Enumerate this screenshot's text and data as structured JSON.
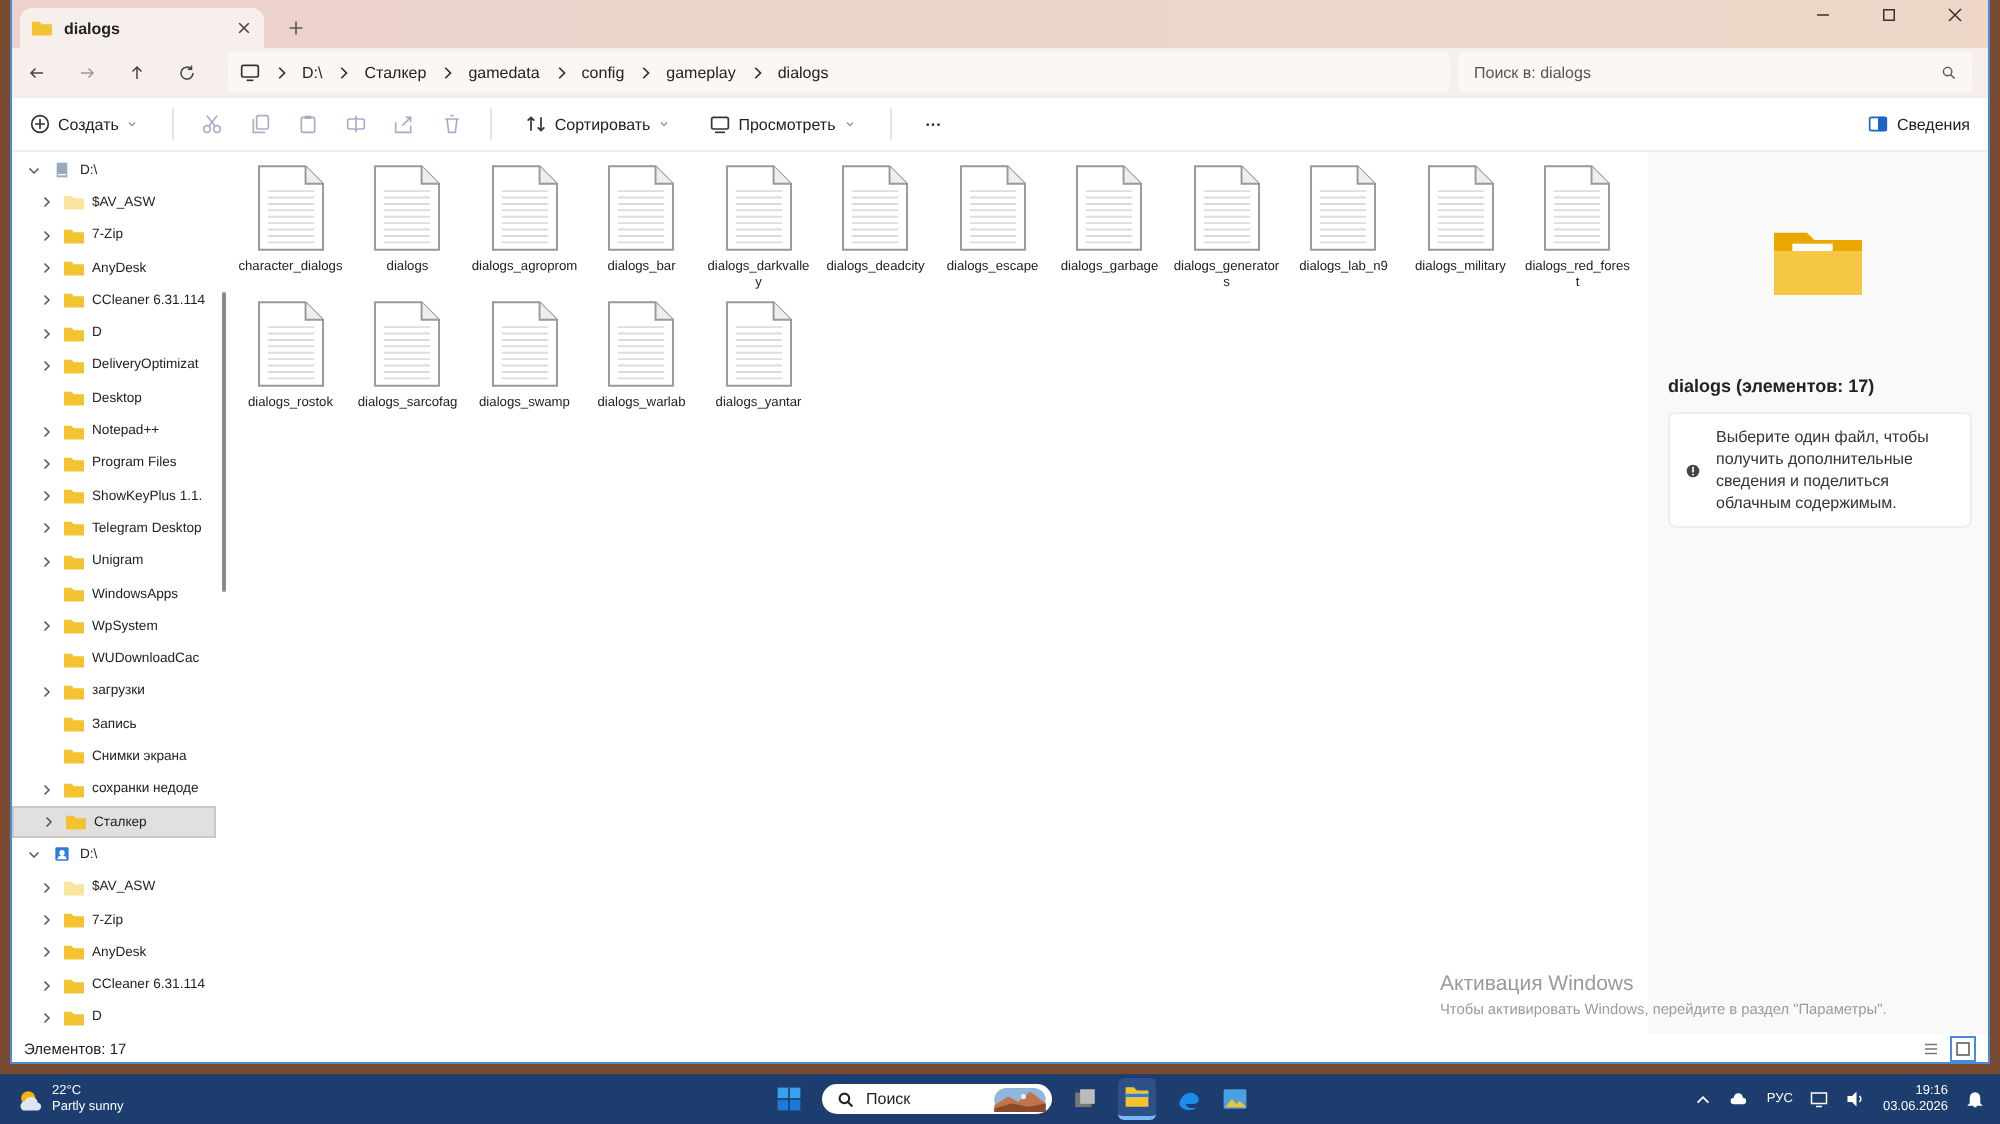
{
  "tabs": [
    {
      "label": "dialogs",
      "selected": true
    }
  ],
  "address_bar": {
    "segments": [
      "D:\\",
      "Сталкер",
      "gamedata",
      "config",
      "gameplay",
      "dialogs"
    ]
  },
  "search": {
    "placeholder": "Поиск в: dialogs"
  },
  "toolbar": {
    "create": "Создать",
    "sort": "Сортировать",
    "view": "Просмотреть",
    "more": "···",
    "details": "Сведения"
  },
  "sidebar": {
    "items": [
      {
        "label": "D:\\",
        "kind": "drive",
        "expanded": true,
        "children": [
          {
            "label": "$AV_ASW",
            "expandable": true,
            "hidden": true,
            "selected": false
          },
          {
            "label": "7-Zip",
            "expandable": true,
            "hidden": false,
            "selected": false
          },
          {
            "label": "AnyDesk",
            "expandable": true,
            "hidden": false,
            "selected": false
          },
          {
            "label": "CCleaner 6.31.114",
            "expandable": true,
            "hidden": false,
            "selected": false
          },
          {
            "label": "D",
            "expandable": true,
            "hidden": false,
            "selected": false
          },
          {
            "label": "DeliveryOptimizat",
            "expandable": true,
            "hidden": false,
            "selected": false
          },
          {
            "label": "Desktop",
            "expandable": false,
            "hidden": false,
            "selected": false
          },
          {
            "label": "Notepad++",
            "expandable": true,
            "hidden": false,
            "selected": false
          },
          {
            "label": "Program Files",
            "expandable": true,
            "hidden": false,
            "selected": false
          },
          {
            "label": "ShowKeyPlus 1.1.",
            "expandable": true,
            "hidden": false,
            "selected": false
          },
          {
            "label": "Telegram Desktop",
            "expandable": true,
            "hidden": false,
            "selected": false
          },
          {
            "label": "Unigram",
            "expandable": true,
            "hidden": false,
            "selected": false
          },
          {
            "label": "WindowsApps",
            "expandable": false,
            "hidden": false,
            "selected": false
          },
          {
            "label": "WpSystem",
            "expandable": true,
            "hidden": false,
            "selected": false
          },
          {
            "label": "WUDownloadCac",
            "expandable": false,
            "hidden": false,
            "selected": false
          },
          {
            "label": "загрузки",
            "expandable": true,
            "hidden": false,
            "selected": false
          },
          {
            "label": "Запись",
            "expandable": false,
            "hidden": false,
            "selected": false
          },
          {
            "label": "Снимки экрана",
            "expandable": false,
            "hidden": false,
            "selected": false
          },
          {
            "label": "сохранки недоде",
            "expandable": true,
            "hidden": false,
            "selected": false
          },
          {
            "label": "Сталкер",
            "expandable": true,
            "hidden": false,
            "selected": true
          }
        ]
      },
      {
        "label": "D:\\",
        "kind": "cloud-drive",
        "expanded": true,
        "children": [
          {
            "label": "$AV_ASW",
            "expandable": true,
            "hidden": true,
            "selected": false
          },
          {
            "label": "7-Zip",
            "expandable": true,
            "hidden": false,
            "selected": false
          },
          {
            "label": "AnyDesk",
            "expandable": true,
            "hidden": false,
            "selected": false
          },
          {
            "label": "CCleaner 6.31.114",
            "expandable": true,
            "hidden": false,
            "selected": false
          },
          {
            "label": "D",
            "expandable": true,
            "hidden": false,
            "selected": false
          }
        ]
      }
    ]
  },
  "files": [
    "character_dialogs",
    "dialogs",
    "dialogs_agroprom",
    "dialogs_bar",
    "dialogs_darkvalley",
    "dialogs_deadcity",
    "dialogs_escape",
    "dialogs_garbage",
    "dialogs_generators",
    "dialogs_lab_n9",
    "dialogs_military",
    "dialogs_red_forest",
    "dialogs_rostok",
    "dialogs_sarcofag",
    "dialogs_swamp",
    "dialogs_warlab",
    "dialogs_yantar"
  ],
  "details_pane": {
    "title": "dialogs (элементов: 17)",
    "message": "Выберите один файл, чтобы получить дополнительные сведения и поделиться облачным содержимым."
  },
  "activation": {
    "title": "Активация Windows",
    "text": "Чтобы активировать Windows, перейдите в раздел \"Параметры\"."
  },
  "status_bar": {
    "count": "Элементов: 17",
    "view_buttons": [
      {
        "kind": "list",
        "selected": false
      },
      {
        "kind": "tiles",
        "selected": true
      }
    ]
  },
  "taskbar": {
    "weather": {
      "temp": "22°C",
      "condition": "Partly sunny"
    },
    "search": "Поиск",
    "language": "РУС",
    "time": "19:16",
    "date": "03.06.2026"
  }
}
